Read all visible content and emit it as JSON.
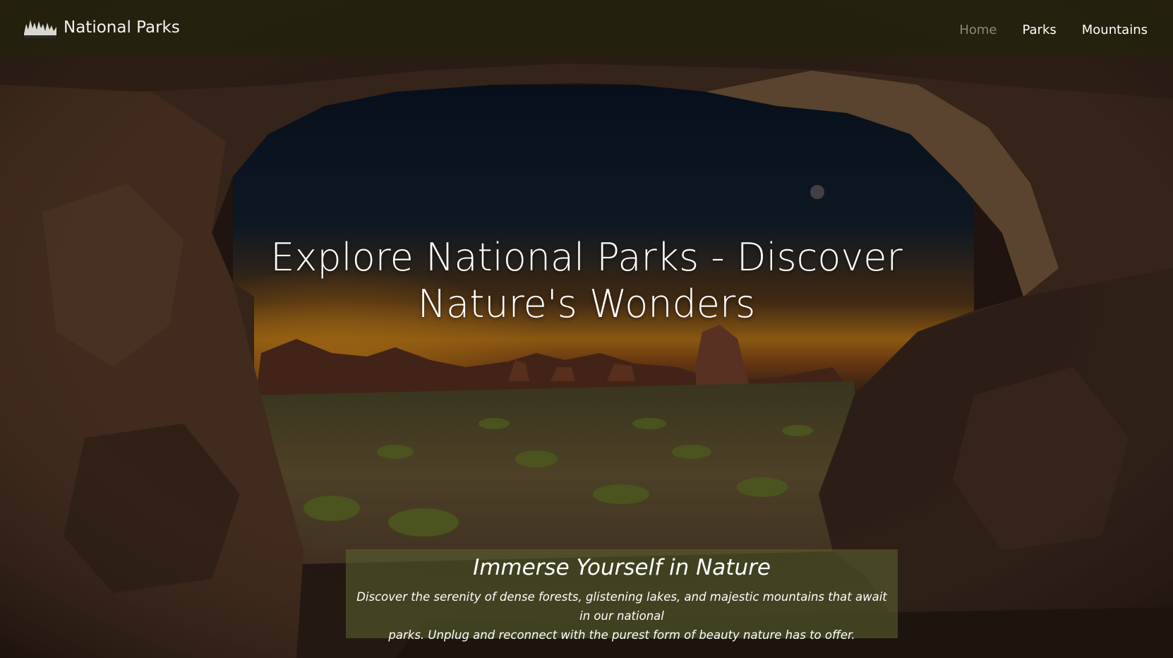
{
  "navbar": {
    "brand_name": "National Parks",
    "logo_icon": "forest-silhouette-logo",
    "links": [
      {
        "label": "Home",
        "active": true
      },
      {
        "label": "Parks",
        "active": false
      },
      {
        "label": "Mountains",
        "active": false
      }
    ]
  },
  "hero": {
    "title_line1": "Explore National Parks - Discover",
    "title_line2": "Nature's Wonders",
    "background_image": "desert-arch-sunset"
  },
  "caption": {
    "title": "Immerse Yourself in Nature",
    "text_line1": "Discover the serenity of dense forests, glistening lakes, and majestic mountains that await in our national",
    "text_line2": "parks. Unplug and reconnect with the purest form of beauty nature has to offer."
  },
  "colors": {
    "navbar_bg": "#24220e",
    "nav_active": "#8a8a80",
    "nav_text": "#ffffff",
    "caption_bg": "#5c6632"
  }
}
